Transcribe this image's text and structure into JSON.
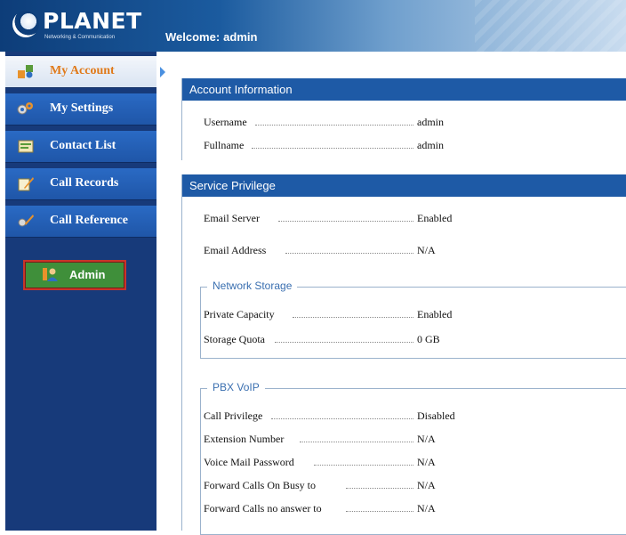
{
  "header": {
    "logo_text": "PLANET",
    "logo_sub": "Networking & Communication",
    "welcome_label": "Welcome:",
    "welcome_user": "admin"
  },
  "sidebar": {
    "items": [
      {
        "label": "My Account",
        "icon": "account-icon"
      },
      {
        "label": "My Settings",
        "icon": "settings-icon"
      },
      {
        "label": "Contact List",
        "icon": "contacts-icon"
      },
      {
        "label": "Call Records",
        "icon": "records-icon"
      },
      {
        "label": "Call Reference",
        "icon": "reference-icon"
      }
    ],
    "admin_label": "Admin"
  },
  "account": {
    "title": "Account Information",
    "rows": [
      {
        "key": "Username",
        "value": "admin"
      },
      {
        "key": "Fullname",
        "value": "admin"
      }
    ]
  },
  "service": {
    "title": "Service Privilege",
    "rows": [
      {
        "key": "Email Server",
        "value": "Enabled"
      },
      {
        "key": "Email Address",
        "value": "N/A"
      }
    ],
    "network_storage": {
      "legend": "Network Storage",
      "rows": [
        {
          "key": "Private Capacity",
          "value": "Enabled"
        },
        {
          "key": "Storage Quota",
          "value": "0 GB"
        }
      ]
    },
    "pbx_voip": {
      "legend": "PBX VoIP",
      "rows": [
        {
          "key": "Call Privilege",
          "value": "Disabled"
        },
        {
          "key": "Extension Number",
          "value": "N/A"
        },
        {
          "key": "Voice Mail Password",
          "value": "N/A"
        },
        {
          "key": "Forward Calls On Busy to",
          "value": "N/A"
        },
        {
          "key": "Forward Calls no answer to",
          "value": "N/A"
        }
      ]
    }
  },
  "colors": {
    "header_dark": "#0d3d79",
    "sidebar_bg": "#173a7a",
    "nav_active_text": "#e07a1a",
    "panel_title_bg": "#1e5aa6",
    "legend_text": "#3a6fb0",
    "admin_button_bg": "#3f8f3a"
  }
}
